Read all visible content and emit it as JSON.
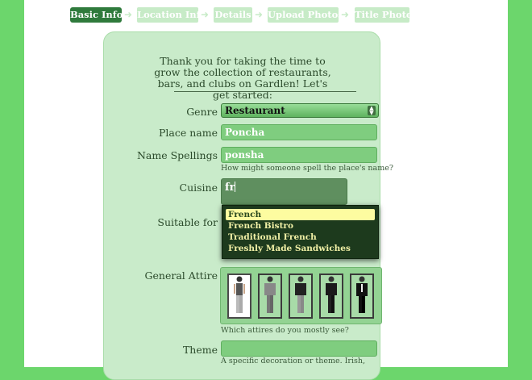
{
  "steps": [
    "Basic Info",
    "Location Info",
    "Details",
    "Upload Photos",
    "Title Photo"
  ],
  "intro_text": "Thank you for taking the time to grow the collection of restaurants, bars, and clubs on Gardlen! Let's get started:",
  "form": {
    "genre_label": "Genre",
    "genre_value": "Restaurant",
    "place_name_label": "Place name",
    "place_name_value": "Poncha",
    "name_spellings_label": "Name Spellings",
    "name_spellings_value": "ponsha",
    "name_spellings_hint": "How might someone spell the place's name?",
    "cuisine_label": "Cuisine",
    "cuisine_value": "fr",
    "suitable_for_label": "Suitable for",
    "general_attire_label": "General Attire",
    "attire_hint": "Which attires do you mostly see?",
    "theme_label": "Theme",
    "theme_value": "",
    "theme_hint": "A specific decoration or theme. Irish,"
  },
  "cuisine_suggestions": [
    "French",
    "French Bistro",
    "Traditional French",
    "Freshly Made Sandwiches"
  ],
  "colors": {
    "background": "#6cd66c",
    "step_active": "#2f7a3c",
    "card": "#c9ebca",
    "field": "#7fcd7f",
    "suggestion_highlight": "#fdfca0"
  }
}
